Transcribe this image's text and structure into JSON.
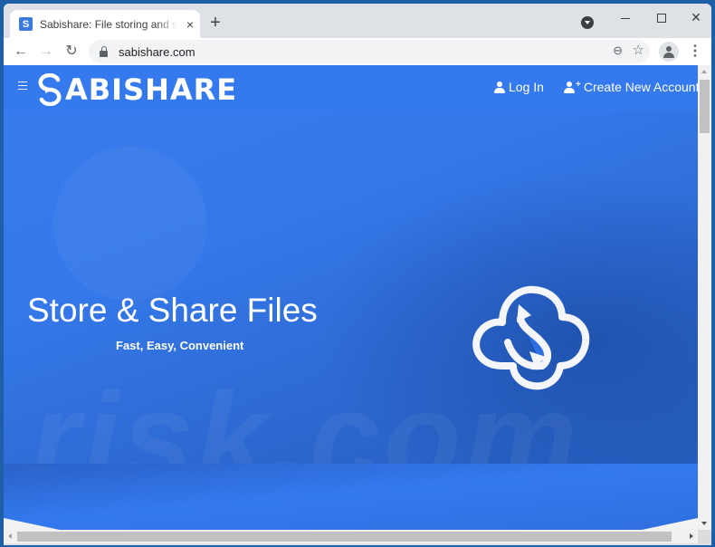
{
  "browser": {
    "tab": {
      "favicon": "S",
      "title": "Sabishare: File storing and sharing",
      "close_icon": "×"
    },
    "new_tab_icon": "+",
    "window_controls": {
      "close": "✕"
    },
    "toolbar": {
      "back_icon": "←",
      "forward_icon": "→",
      "reload_icon": "↻",
      "url": "sabishare.com",
      "zoom_icon": "⊖",
      "bookmark_icon": "☆",
      "menu_icon": "⋮"
    }
  },
  "site": {
    "brand": "ABISHARE",
    "brand_full": "SABISHARE",
    "nav": {
      "login": "Log In",
      "create_account": "Create New Account",
      "plus": "+"
    },
    "hero": {
      "title": "Store & Share Files",
      "subtitle": "Fast, Easy, Convenient"
    },
    "watermark": "risk.com"
  },
  "colors": {
    "brand_blue": "#3479ed",
    "hero_dark": "#2359b8",
    "white": "#ffffff"
  }
}
